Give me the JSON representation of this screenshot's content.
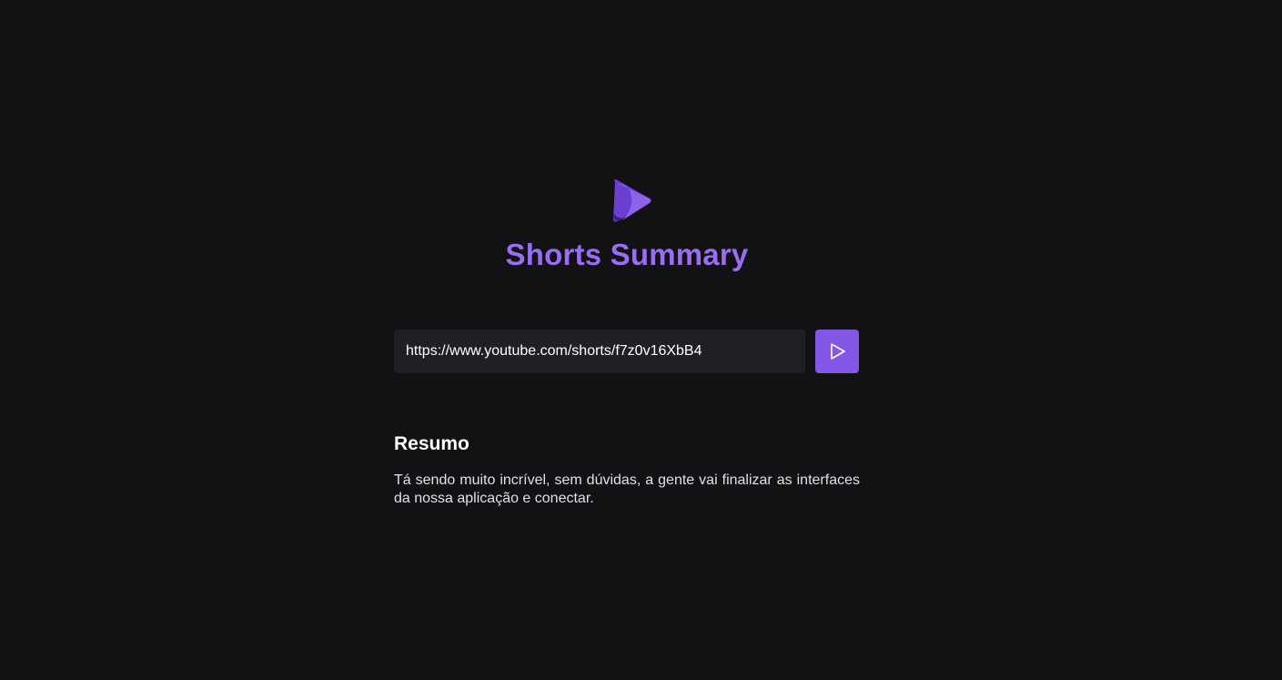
{
  "app": {
    "title": "Shorts Summary",
    "logo_icon": "play-logo-icon",
    "accent_color": "#8257e5",
    "title_color": "#9b6cf4"
  },
  "form": {
    "url_value": "https://www.youtube.com/shorts/f7z0v16XbB4",
    "submit_icon": "play-icon"
  },
  "summary": {
    "heading": "Resumo",
    "text": "Tá sendo muito incrível, sem dúvidas, a gente vai finalizar as interfaces da nossa aplicação e conectar."
  }
}
